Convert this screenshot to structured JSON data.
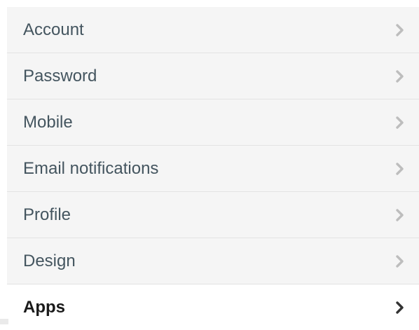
{
  "settings_menu": {
    "items": [
      {
        "label": "Account",
        "icon": "chevron-right-icon",
        "active": false
      },
      {
        "label": "Password",
        "icon": "chevron-right-icon",
        "active": false
      },
      {
        "label": "Mobile",
        "icon": "chevron-right-icon",
        "active": false
      },
      {
        "label": "Email notifications",
        "icon": "chevron-right-icon",
        "active": false
      },
      {
        "label": "Profile",
        "icon": "chevron-right-icon",
        "active": false
      },
      {
        "label": "Design",
        "icon": "chevron-right-icon",
        "active": false
      },
      {
        "label": "Apps",
        "icon": "chevron-right-icon",
        "active": true
      }
    ]
  },
  "colors": {
    "item_background": "#f5f5f5",
    "active_background": "#ffffff",
    "label_text": "#44555f",
    "active_label_text": "#1a1a1a",
    "chevron": "#bdbdbd",
    "active_chevron": "#333333",
    "divider": "#e3e3e3"
  }
}
